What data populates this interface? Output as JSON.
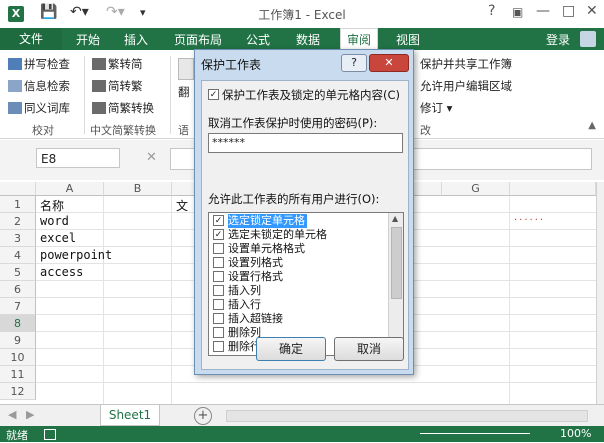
{
  "window": {
    "title": "工作簿1 - Excel",
    "help": "?",
    "minimize": "—",
    "restore": "□",
    "close": "✕",
    "login": "登录"
  },
  "tabs": [
    "文件",
    "开始",
    "插入",
    "页面布局",
    "公式",
    "数据",
    "审阅",
    "视图"
  ],
  "ribbon": {
    "proofing": {
      "items": [
        "拼写检查",
        "信息检索",
        "同义词库"
      ],
      "group": "校对"
    },
    "chinese": {
      "items": [
        "繁转简",
        "简转繁",
        "简繁转换"
      ],
      "group": "中文简繁转换"
    },
    "partial": {
      "top": "翻",
      "group_fragment": "语",
      "changes_fragment": "改"
    },
    "changes": {
      "items": [
        "保护并共享工作簿",
        "允许用户编辑区域",
        "修订 ▾"
      ]
    }
  },
  "formula_bar": {
    "cell_ref": "E8"
  },
  "sheet": {
    "columns": [
      "A",
      "B",
      "G"
    ],
    "rows": [
      "1",
      "2",
      "3",
      "4",
      "5",
      "6",
      "7",
      "8",
      "9",
      "10",
      "11",
      "12"
    ],
    "cells": [
      "名称",
      "word",
      "excel",
      "powerpoint",
      "access"
    ],
    "b1_fragment": "文",
    "watermark": "......"
  },
  "sheet_tabs": {
    "sheet1": "Sheet1",
    "add": "+"
  },
  "status": {
    "left": "就绪",
    "zoom": "100%"
  },
  "dialog": {
    "title": "保护工作表",
    "help": "?",
    "close": "✕",
    "protect_label": "保护工作表及锁定的单元格内容(C)",
    "protect_checked": true,
    "password_label": "取消工作表保护时使用的密码(P):",
    "password_value": "******",
    "allow_label": "允许此工作表的所有用户进行(O):",
    "options": [
      {
        "label": "选定锁定单元格",
        "checked": true,
        "selected": true
      },
      {
        "label": "选定未锁定的单元格",
        "checked": true
      },
      {
        "label": "设置单元格格式",
        "checked": false
      },
      {
        "label": "设置列格式",
        "checked": false
      },
      {
        "label": "设置行格式",
        "checked": false
      },
      {
        "label": "插入列",
        "checked": false
      },
      {
        "label": "插入行",
        "checked": false
      },
      {
        "label": "插入超链接",
        "checked": false
      },
      {
        "label": "删除列",
        "checked": false
      },
      {
        "label": "删除行",
        "checked": false
      }
    ],
    "ok": "确定",
    "cancel": "取消"
  },
  "colors": {
    "excel_green": "#217346",
    "dialog_frame": "#c9dcef",
    "selection": "#3399ff"
  }
}
